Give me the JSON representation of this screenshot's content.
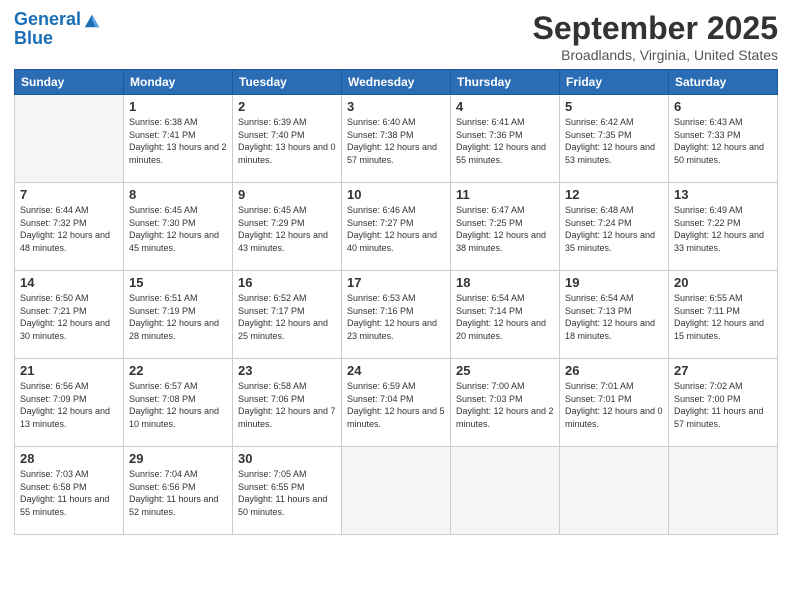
{
  "header": {
    "logo_line1": "General",
    "logo_line2": "Blue",
    "month_title": "September 2025",
    "location": "Broadlands, Virginia, United States"
  },
  "weekdays": [
    "Sunday",
    "Monday",
    "Tuesday",
    "Wednesday",
    "Thursday",
    "Friday",
    "Saturday"
  ],
  "weeks": [
    [
      {
        "day": "",
        "empty": true
      },
      {
        "day": "1",
        "sunrise": "6:38 AM",
        "sunset": "7:41 PM",
        "daylight": "13 hours and 2 minutes."
      },
      {
        "day": "2",
        "sunrise": "6:39 AM",
        "sunset": "7:40 PM",
        "daylight": "13 hours and 0 minutes."
      },
      {
        "day": "3",
        "sunrise": "6:40 AM",
        "sunset": "7:38 PM",
        "daylight": "12 hours and 57 minutes."
      },
      {
        "day": "4",
        "sunrise": "6:41 AM",
        "sunset": "7:36 PM",
        "daylight": "12 hours and 55 minutes."
      },
      {
        "day": "5",
        "sunrise": "6:42 AM",
        "sunset": "7:35 PM",
        "daylight": "12 hours and 53 minutes."
      },
      {
        "day": "6",
        "sunrise": "6:43 AM",
        "sunset": "7:33 PM",
        "daylight": "12 hours and 50 minutes."
      }
    ],
    [
      {
        "day": "7",
        "sunrise": "6:44 AM",
        "sunset": "7:32 PM",
        "daylight": "12 hours and 48 minutes."
      },
      {
        "day": "8",
        "sunrise": "6:45 AM",
        "sunset": "7:30 PM",
        "daylight": "12 hours and 45 minutes."
      },
      {
        "day": "9",
        "sunrise": "6:45 AM",
        "sunset": "7:29 PM",
        "daylight": "12 hours and 43 minutes."
      },
      {
        "day": "10",
        "sunrise": "6:46 AM",
        "sunset": "7:27 PM",
        "daylight": "12 hours and 40 minutes."
      },
      {
        "day": "11",
        "sunrise": "6:47 AM",
        "sunset": "7:25 PM",
        "daylight": "12 hours and 38 minutes."
      },
      {
        "day": "12",
        "sunrise": "6:48 AM",
        "sunset": "7:24 PM",
        "daylight": "12 hours and 35 minutes."
      },
      {
        "day": "13",
        "sunrise": "6:49 AM",
        "sunset": "7:22 PM",
        "daylight": "12 hours and 33 minutes."
      }
    ],
    [
      {
        "day": "14",
        "sunrise": "6:50 AM",
        "sunset": "7:21 PM",
        "daylight": "12 hours and 30 minutes."
      },
      {
        "day": "15",
        "sunrise": "6:51 AM",
        "sunset": "7:19 PM",
        "daylight": "12 hours and 28 minutes."
      },
      {
        "day": "16",
        "sunrise": "6:52 AM",
        "sunset": "7:17 PM",
        "daylight": "12 hours and 25 minutes."
      },
      {
        "day": "17",
        "sunrise": "6:53 AM",
        "sunset": "7:16 PM",
        "daylight": "12 hours and 23 minutes."
      },
      {
        "day": "18",
        "sunrise": "6:54 AM",
        "sunset": "7:14 PM",
        "daylight": "12 hours and 20 minutes."
      },
      {
        "day": "19",
        "sunrise": "6:54 AM",
        "sunset": "7:13 PM",
        "daylight": "12 hours and 18 minutes."
      },
      {
        "day": "20",
        "sunrise": "6:55 AM",
        "sunset": "7:11 PM",
        "daylight": "12 hours and 15 minutes."
      }
    ],
    [
      {
        "day": "21",
        "sunrise": "6:56 AM",
        "sunset": "7:09 PM",
        "daylight": "12 hours and 13 minutes."
      },
      {
        "day": "22",
        "sunrise": "6:57 AM",
        "sunset": "7:08 PM",
        "daylight": "12 hours and 10 minutes."
      },
      {
        "day": "23",
        "sunrise": "6:58 AM",
        "sunset": "7:06 PM",
        "daylight": "12 hours and 7 minutes."
      },
      {
        "day": "24",
        "sunrise": "6:59 AM",
        "sunset": "7:04 PM",
        "daylight": "12 hours and 5 minutes."
      },
      {
        "day": "25",
        "sunrise": "7:00 AM",
        "sunset": "7:03 PM",
        "daylight": "12 hours and 2 minutes."
      },
      {
        "day": "26",
        "sunrise": "7:01 AM",
        "sunset": "7:01 PM",
        "daylight": "12 hours and 0 minutes."
      },
      {
        "day": "27",
        "sunrise": "7:02 AM",
        "sunset": "7:00 PM",
        "daylight": "11 hours and 57 minutes."
      }
    ],
    [
      {
        "day": "28",
        "sunrise": "7:03 AM",
        "sunset": "6:58 PM",
        "daylight": "11 hours and 55 minutes."
      },
      {
        "day": "29",
        "sunrise": "7:04 AM",
        "sunset": "6:56 PM",
        "daylight": "11 hours and 52 minutes."
      },
      {
        "day": "30",
        "sunrise": "7:05 AM",
        "sunset": "6:55 PM",
        "daylight": "11 hours and 50 minutes."
      },
      {
        "day": "",
        "empty": true
      },
      {
        "day": "",
        "empty": true
      },
      {
        "day": "",
        "empty": true
      },
      {
        "day": "",
        "empty": true
      }
    ]
  ]
}
